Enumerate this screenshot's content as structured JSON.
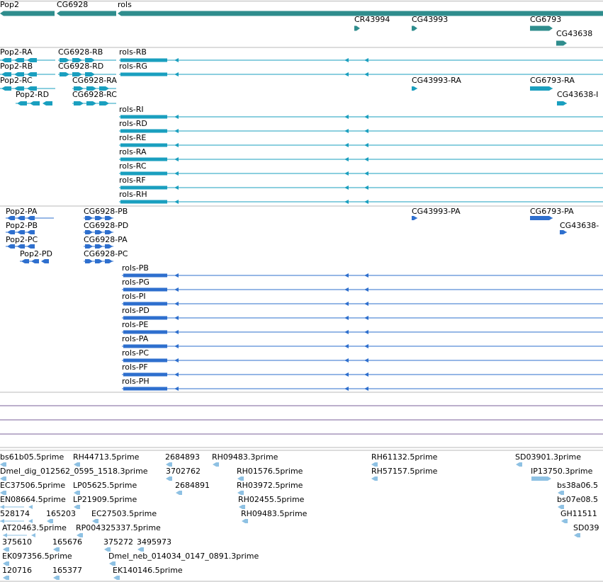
{
  "colors": {
    "gene": "#2f8d8d",
    "transcript": "#1a9fbf",
    "protein": "#2e6fce",
    "est": "#8ec1e3",
    "divider": "#b9b9b9",
    "empty_track": "#7a5f98"
  },
  "genes": [
    {
      "label": "Pop2",
      "dir": "-"
    },
    {
      "label": "CG6928",
      "dir": "-"
    },
    {
      "label": "rols",
      "dir": "-"
    },
    {
      "label": "CR43994",
      "dir": "+"
    },
    {
      "label": "CG43993",
      "dir": "+"
    },
    {
      "label": "CG6793",
      "dir": "+"
    },
    {
      "label": "CG43638",
      "dir": "+"
    }
  ],
  "transcripts": [
    "Pop2-RA",
    "Pop2-RB",
    "Pop2-RC",
    "Pop2-RD",
    "CG6928-RB",
    "CG6928-RD",
    "CG6928-RA",
    "CG6928-RC",
    "rols-RB",
    "rols-RG",
    "rols-RI",
    "rols-RD",
    "rols-RE",
    "rols-RA",
    "rols-RC",
    "rols-RF",
    "rols-RH",
    "CG43993-RA",
    "CG6793-RA",
    "CG43638-I"
  ],
  "proteins": [
    "Pop2-PA",
    "Pop2-PB",
    "Pop2-PC",
    "Pop2-PD",
    "CG6928-PB",
    "CG6928-PD",
    "CG6928-PA",
    "CG6928-PC",
    "rols-PB",
    "rols-PG",
    "rols-PI",
    "rols-PD",
    "rols-PE",
    "rols-PA",
    "rols-PC",
    "rols-PF",
    "rols-PH",
    "CG43993-PA",
    "CG6793-PA",
    "CG43638-"
  ],
  "ests": [
    "bs61b05.5prime",
    "RH44713.5prime",
    "2684893",
    "RH09483.3prime",
    "RH61132.5prime",
    "SD03901.3prime",
    "Dmel_dig_012562_0595_1518.3prime",
    "3702762",
    "RH01576.5prime",
    "RH57157.5prime",
    "IP13750.3prime",
    "EC37506.5prime",
    "LP05625.5prime",
    "2684891",
    "RH03972.5prime",
    "bs38a06.5",
    "EN08664.5prime",
    "LP21909.5prime",
    "RH02455.5prime",
    "bs07e08.5",
    "528174",
    "165203",
    "EC27503.5prime",
    "RH09483.5prime",
    "GH11511",
    "AT20463.5prime",
    "RP004325337.5prime",
    "SD039",
    "375610",
    "165676",
    "375272",
    "3495973",
    "EK097356.5prime",
    "Dmel_neb_014034_0147_0891.3prime",
    "120716",
    "165377",
    "EK140146.5prime"
  ]
}
